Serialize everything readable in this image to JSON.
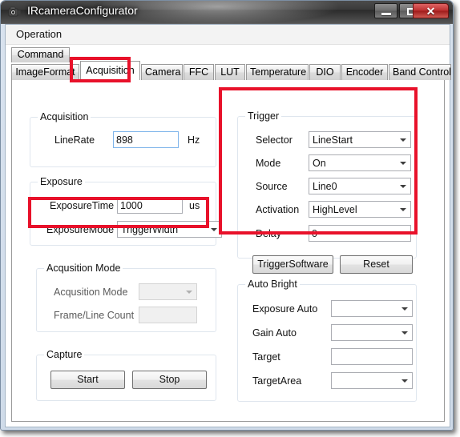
{
  "window": {
    "title": "IRcameraConfigurator",
    "icon": "camera-icon",
    "minimize_label": "–",
    "maximize_label": "□",
    "close_label": "✕"
  },
  "menubar": {
    "items": [
      {
        "label": "Operation"
      }
    ]
  },
  "tabs": {
    "row1": [
      {
        "label": "Command",
        "selected": false
      }
    ],
    "row2": [
      {
        "label": "ImageFormat",
        "selected": false
      },
      {
        "label": "Acquisition",
        "selected": true
      },
      {
        "label": "Camera",
        "selected": false
      },
      {
        "label": "FFC",
        "selected": false
      },
      {
        "label": "LUT",
        "selected": false
      },
      {
        "label": "Temperature",
        "selected": false
      },
      {
        "label": "DIO",
        "selected": false
      },
      {
        "label": "Encoder",
        "selected": false
      },
      {
        "label": "Band Control",
        "selected": false
      }
    ]
  },
  "acquisition_group": {
    "title": "Acquisition",
    "line_rate_label": "LineRate",
    "line_rate_value": "898",
    "line_rate_unit": "Hz"
  },
  "exposure_group": {
    "title": "Exposure",
    "exposure_time_label": "ExposureTime",
    "exposure_time_value": "1000",
    "exposure_time_unit": "us",
    "exposure_mode_label": "ExposureMode",
    "exposure_mode_value": "TriggerWidth"
  },
  "acquisition_mode_group": {
    "title": "Acqusition Mode",
    "mode_label": "Acqusition Mode",
    "mode_value": "",
    "frame_line_count_label": "Frame/Line Count",
    "frame_line_count_value": ""
  },
  "capture_group": {
    "title": "Capture",
    "start_label": "Start",
    "stop_label": "Stop"
  },
  "trigger_group": {
    "title": "Trigger",
    "selector_label": "Selector",
    "selector_value": "LineStart",
    "mode_label": "Mode",
    "mode_value": "On",
    "source_label": "Source",
    "source_value": "Line0",
    "activation_label": "Activation",
    "activation_value": "HighLevel",
    "delay_label": "Delay",
    "delay_value": "0",
    "trigger_software_label": "TriggerSoftware",
    "reset_label": "Reset"
  },
  "auto_bright_group": {
    "title": "Auto Bright",
    "exposure_auto_label": "Exposure Auto",
    "exposure_auto_value": "",
    "gain_auto_label": "Gain Auto",
    "gain_auto_value": "",
    "target_label": "Target",
    "target_value": "",
    "target_area_label": "TargetArea",
    "target_area_value": ""
  },
  "annotations": {
    "highlight_color": "#e8112a",
    "boxes": [
      {
        "name": "acquisition-tab-highlight"
      },
      {
        "name": "exposure-mode-highlight"
      },
      {
        "name": "trigger-group-highlight"
      }
    ]
  }
}
